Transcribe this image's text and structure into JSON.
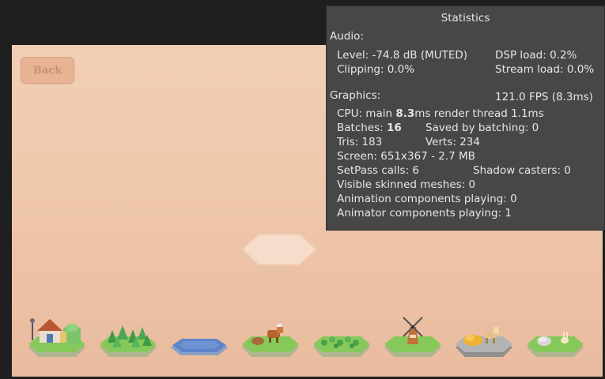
{
  "game": {
    "back_label": "Back",
    "tiles": [
      {
        "name": "house-tile-icon"
      },
      {
        "name": "forest-tile-icon"
      },
      {
        "name": "water-tile-icon"
      },
      {
        "name": "animals-tile-icon"
      },
      {
        "name": "crops-tile-icon"
      },
      {
        "name": "windmill-tile-icon"
      },
      {
        "name": "quarry-tile-icon"
      },
      {
        "name": "rock-tile-icon"
      }
    ]
  },
  "stats": {
    "title": "Statistics",
    "audio_header": "Audio:",
    "level": "Level: -74.8 dB (MUTED)",
    "dsp_load": "DSP load: 0.2%",
    "clipping": "Clipping: 0.0%",
    "stream_load": "Stream load: 0.0%",
    "graphics_header": "Graphics:",
    "fps": "121.0 FPS (8.3ms)",
    "cpu_prefix": "CPU: main ",
    "cpu_main": "8.3",
    "cpu_suffix": "ms  render thread 1.1ms",
    "batches_prefix": "Batches: ",
    "batches": "16",
    "saved_batching": "Saved by batching: 0",
    "tris": "Tris: 183",
    "verts": "Verts: 234",
    "screen": "Screen: 651x367 - 2.7 MB",
    "setpass": "SetPass calls: 6",
    "shadow_casters": "Shadow casters: 0",
    "skinned_meshes": "Visible skinned meshes: 0",
    "animation_components": "Animation components playing: 0",
    "animator_components": "Animator components playing: 1"
  }
}
